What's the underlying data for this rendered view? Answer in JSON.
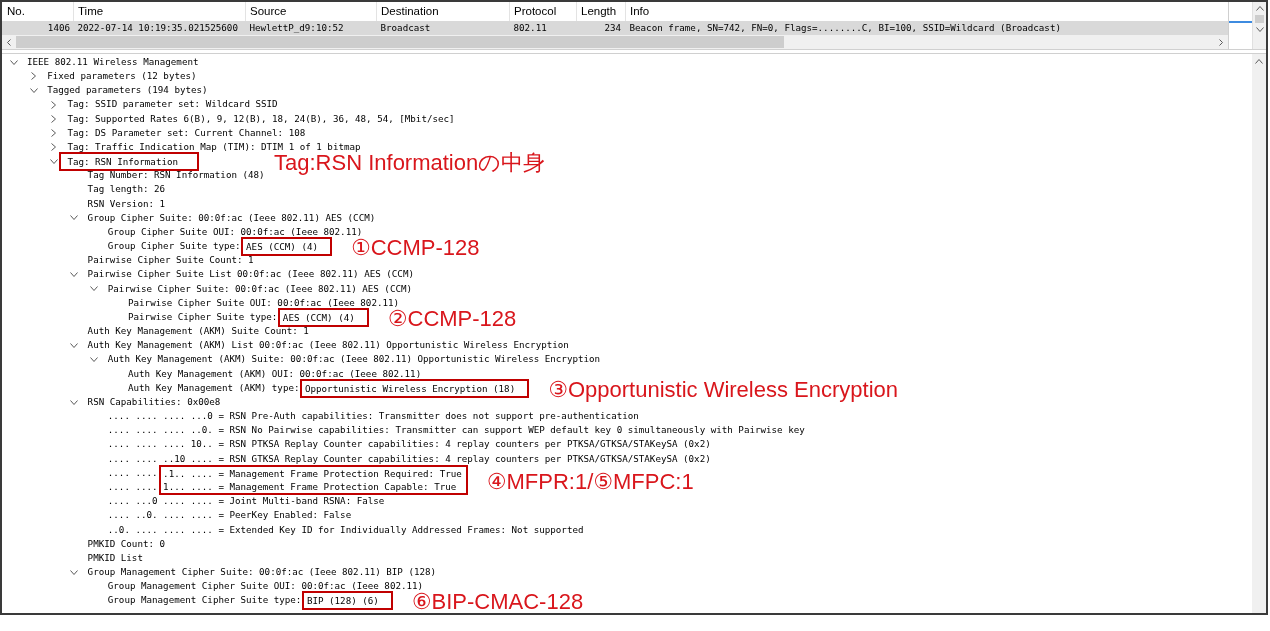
{
  "packet_list": {
    "columns": [
      "No.",
      "Time",
      "Source",
      "Destination",
      "Protocol",
      "Length",
      "Info"
    ],
    "rows": [
      {
        "selected": true,
        "cells": [
          "1406",
          "2022-07-14 10:19:35.021525600",
          "HewlettP_d9:10:52",
          "Broadcast",
          "802.11",
          "234",
          "Beacon frame, SN=742, FN=0, Flags=........C, BI=100, SSID=Wildcard (Broadcast)"
        ]
      }
    ]
  },
  "details": {
    "tree": [
      {
        "text": "IEEE 802.11 Wireless Management",
        "expanded": true,
        "children": [
          {
            "text": "Fixed parameters (12 bytes)",
            "expanded": false
          },
          {
            "text": "Tagged parameters (194 bytes)",
            "expanded": true,
            "children": [
              {
                "text": "Tag: SSID parameter set: Wildcard SSID",
                "expanded": false
              },
              {
                "text": "Tag: Supported Rates 6(B), 9, 12(B), 18, 24(B), 36, 48, 54, [Mbit/sec]",
                "expanded": false
              },
              {
                "text": "Tag: DS Parameter set: Current Channel: 108",
                "expanded": false
              },
              {
                "text": "Tag: Traffic Indication Map (TIM): DTIM 1 of 1 bitmap",
                "expanded": false
              },
              {
                "boxed": "Tag: RSN Information",
                "note": "Tag:RSN Informationの中身",
                "expanded": true,
                "children": [
                  {
                    "text": "Tag Number: RSN Information (48)"
                  },
                  {
                    "text": "Tag length: 26"
                  },
                  {
                    "text": "RSN Version: 1"
                  },
                  {
                    "text": "Group Cipher Suite: 00:0f:ac (Ieee 802.11) AES (CCM)",
                    "expanded": true,
                    "children": [
                      {
                        "text": "Group Cipher Suite OUI: 00:0f:ac (Ieee 802.11)"
                      },
                      {
                        "text": "Group Cipher Suite type:",
                        "boxed": "AES (CCM) (4)",
                        "note": "①CCMP-128"
                      }
                    ]
                  },
                  {
                    "text": "Pairwise Cipher Suite Count: 1"
                  },
                  {
                    "text": "Pairwise Cipher Suite List 00:0f:ac (Ieee 802.11) AES (CCM)",
                    "expanded": true,
                    "children": [
                      {
                        "text": "Pairwise Cipher Suite: 00:0f:ac (Ieee 802.11) AES (CCM)",
                        "expanded": true,
                        "children": [
                          {
                            "text": "Pairwise Cipher Suite OUI: 00:0f:ac (Ieee 802.11)"
                          },
                          {
                            "text": "Pairwise Cipher Suite type:",
                            "boxed": "AES (CCM) (4)",
                            "note": "②CCMP-128"
                          }
                        ]
                      }
                    ]
                  },
                  {
                    "text": "Auth Key Management (AKM) Suite Count: 1"
                  },
                  {
                    "text": "Auth Key Management (AKM) List 00:0f:ac (Ieee 802.11) Opportunistic Wireless Encryption",
                    "expanded": true,
                    "children": [
                      {
                        "text": "Auth Key Management (AKM) Suite: 00:0f:ac (Ieee 802.11) Opportunistic Wireless Encryption",
                        "expanded": true,
                        "children": [
                          {
                            "text": "Auth Key Management (AKM) OUI: 00:0f:ac (Ieee 802.11)"
                          },
                          {
                            "text": "Auth Key Management (AKM) type:",
                            "boxed": "Opportunistic Wireless Encryption (18)",
                            "note": "③Opportunistic Wireless Encryption"
                          }
                        ]
                      }
                    ]
                  },
                  {
                    "text": "RSN Capabilities: 0x00e8",
                    "expanded": true,
                    "children": [
                      {
                        "kind": "field",
                        "text": ".... .... .... ...0 = RSN Pre-Auth capabilities: Transmitter does not support pre-authentication"
                      },
                      {
                        "kind": "field",
                        "text": ".... .... .... ..0. = RSN No Pairwise capabilities: Transmitter can support WEP default key 0 simultaneously with Pairwise key"
                      },
                      {
                        "kind": "field",
                        "text": ".... .... .... 10.. = RSN PTKSA Replay Counter capabilities: 4 replay counters per PTKSA/GTKSA/STAKeySA (0x2)"
                      },
                      {
                        "kind": "field",
                        "text": ".... .... ..10 .... = RSN GTKSA Replay Counter capabilities: 4 replay counters per PTKSA/GTKSA/STAKeySA (0x2)"
                      },
                      {
                        "kind": "boxed_group",
                        "note": "④MFPR:1/⑤MFPC:1",
                        "rows": [
                          {
                            "text": ".... ....",
                            "boxed": ".1.. .... = Management Frame Protection Required: True"
                          },
                          {
                            "text": ".... ....",
                            "boxed": "1... .... = Management Frame Protection Capable: True"
                          }
                        ]
                      },
                      {
                        "kind": "field",
                        "text": ".... ...0 .... .... = Joint Multi-band RSNA: False"
                      },
                      {
                        "kind": "field",
                        "text": ".... ..0. .... .... = PeerKey Enabled: False"
                      },
                      {
                        "kind": "field",
                        "text": "..0. .... .... .... = Extended Key ID for Individually Addressed Frames: Not supported"
                      }
                    ]
                  },
                  {
                    "text": "PMKID Count: 0"
                  },
                  {
                    "text": "PMKID List"
                  },
                  {
                    "text": "Group Management Cipher Suite: 00:0f:ac (Ieee 802.11) BIP (128)",
                    "expanded": true,
                    "children": [
                      {
                        "text": "Group Management Cipher Suite OUI: 00:0f:ac (Ieee 802.11)"
                      },
                      {
                        "text": "Group Management Cipher Suite type:",
                        "boxed": "BIP (128) (6)",
                        "note": "⑥BIP-CMAC-128"
                      }
                    ]
                  }
                ]
              }
            ]
          }
        ]
      }
    ]
  }
}
